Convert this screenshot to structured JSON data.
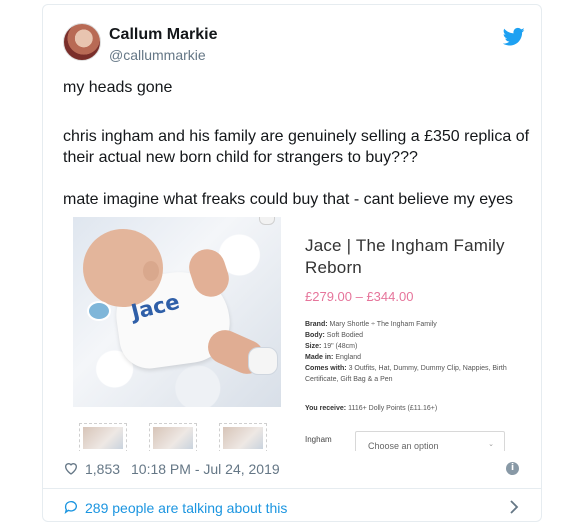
{
  "author": {
    "name": "Callum Markie",
    "handle": "@callummarkie"
  },
  "tweet": {
    "line1": "my heads gone",
    "line2": "chris ingham and his family are genuinely selling a £350 replica of their actual new born child for strangers to buy???",
    "line3": "mate imagine what freaks could buy that - cant believe my eyes"
  },
  "embed": {
    "baby_onesie_text": "Jace",
    "product_title": "Jace | The Ingham Family Reborn",
    "price": "£279.00 – £344.00",
    "specs": [
      {
        "label": "Brand:",
        "value": "Mary Shortle ÷ The Ingham Family"
      },
      {
        "label": "Body:",
        "value": "Soft Bodied"
      },
      {
        "label": "Size:",
        "value": "19\" (48cm)"
      },
      {
        "label": "Made in:",
        "value": "England"
      },
      {
        "label": "Comes with:",
        "value": "3 Outfits, Hat, Dummy, Dummy Clip, Nappies, Birth Certificate, Gift Bag & a Pen"
      }
    ],
    "receive_label": "You receive:",
    "receive_value": "1116+ Dolly Points (£11.16+)",
    "option_label": "Ingham",
    "select_placeholder": "Choose an option"
  },
  "meta": {
    "likes": "1,853",
    "datetime": "10:18 PM - Jul 24, 2019"
  },
  "footer": {
    "talking": "289 people are talking about this"
  },
  "colors": {
    "twitter_blue": "#1da1f2",
    "link_blue": "#1b95e0",
    "price_pink": "#e6759b",
    "meta_gray": "#657786"
  },
  "icons": [
    "twitter-bird-icon",
    "heart-icon",
    "info-icon",
    "comment-bubble-icon",
    "chevron-right-icon"
  ]
}
